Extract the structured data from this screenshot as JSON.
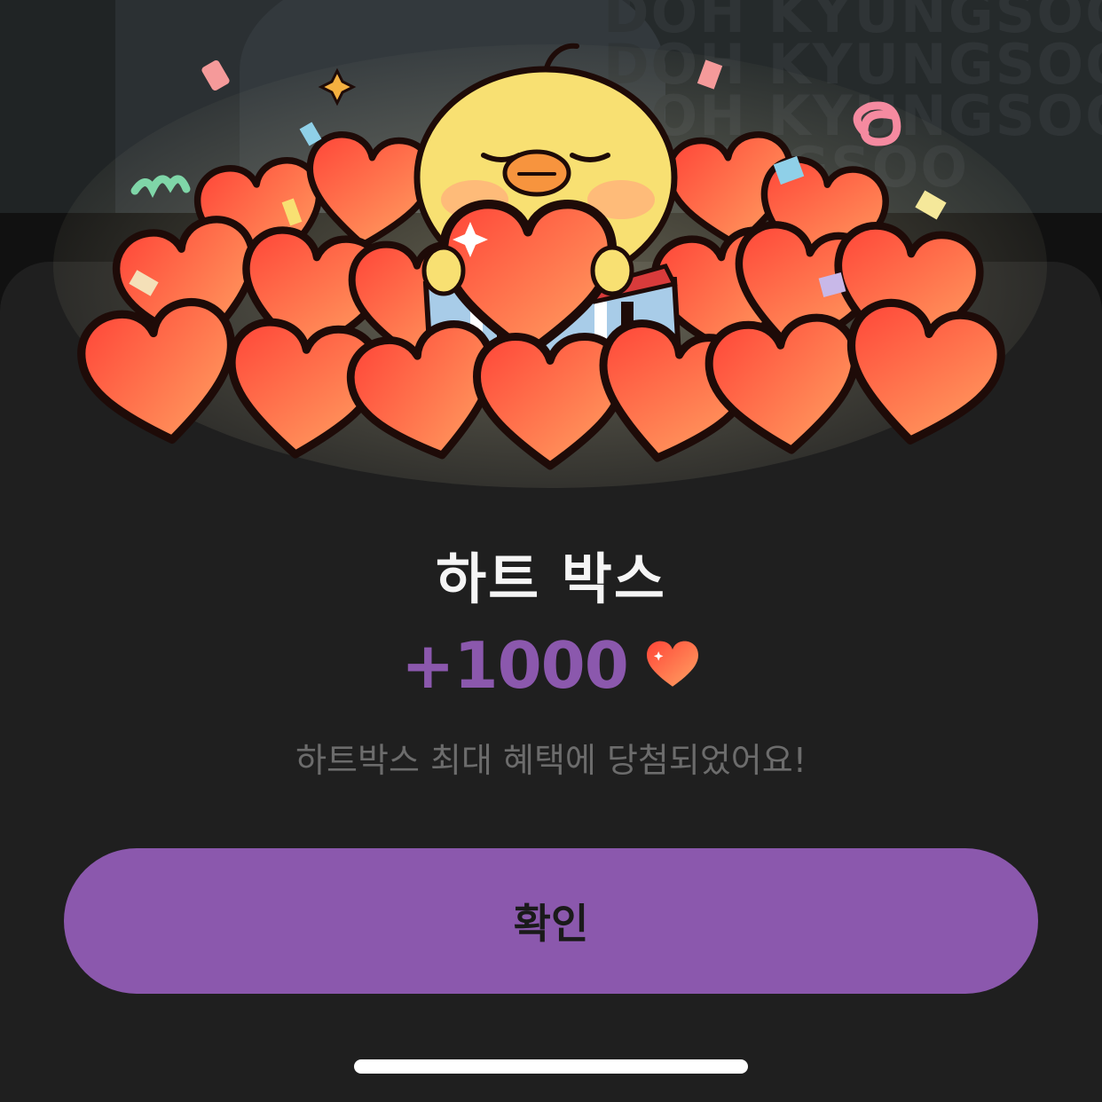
{
  "background": {
    "watermark_lines": [
      "DOH KYUNGSOO",
      "DOH KYUNGSOO",
      "DOH KYUNGSOO",
      "KYUNGSOO"
    ]
  },
  "modal": {
    "title": "하트 박스",
    "reward_amount": "+1000",
    "reward_icon": "heart-icon",
    "message": "하트박스 최대 혜택에 당첨되었어요!",
    "confirm_label": "확인"
  },
  "colors": {
    "accent": "#8b58ad",
    "sheet_background": "#1f1f1f",
    "heart_red": "#ff4d3d",
    "heart_orange": "#ff9a5c"
  }
}
